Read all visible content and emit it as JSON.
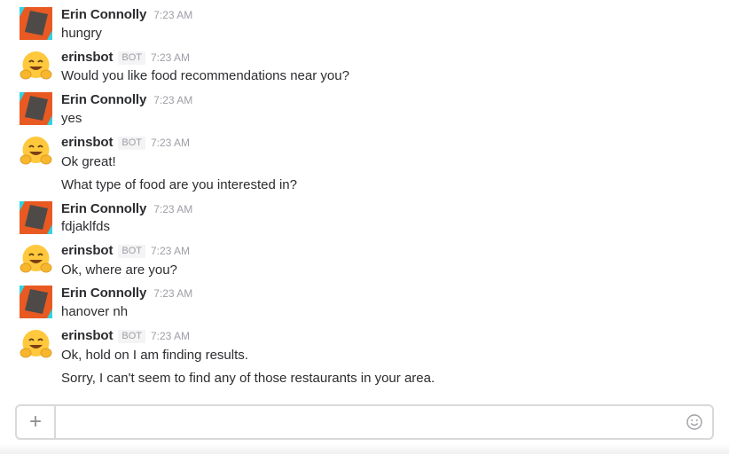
{
  "messages": [
    {
      "sender": "Erin Connolly",
      "is_bot": false,
      "time": "7:23 AM",
      "lines": [
        "hungry"
      ]
    },
    {
      "sender": "erinsbot",
      "is_bot": true,
      "badge": "BOT",
      "time": "7:23 AM",
      "lines": [
        "Would you like food recommendations near you?"
      ]
    },
    {
      "sender": "Erin Connolly",
      "is_bot": false,
      "time": "7:23 AM",
      "lines": [
        "yes"
      ]
    },
    {
      "sender": "erinsbot",
      "is_bot": true,
      "badge": "BOT",
      "time": "7:23 AM",
      "lines": [
        "Ok great!",
        "What type of food are you interested in?"
      ]
    },
    {
      "sender": "Erin Connolly",
      "is_bot": false,
      "time": "7:23 AM",
      "lines": [
        "fdjaklfds"
      ]
    },
    {
      "sender": "erinsbot",
      "is_bot": true,
      "badge": "BOT",
      "time": "7:23 AM",
      "lines": [
        "Ok, where are you?"
      ]
    },
    {
      "sender": "Erin Connolly",
      "is_bot": false,
      "time": "7:23 AM",
      "lines": [
        "hanover nh"
      ]
    },
    {
      "sender": "erinsbot",
      "is_bot": true,
      "badge": "BOT",
      "time": "7:23 AM",
      "lines": [
        "Ok, hold on I am finding results.",
        "Sorry, I can't seem to find any of those restaurants in your area."
      ]
    }
  ],
  "composer": {
    "plus_label": "+",
    "input_value": "",
    "input_placeholder": "",
    "emoji_icon": "smiley-face-icon",
    "plus_icon": "plus-icon"
  },
  "icons": {
    "user_avatar": "erin-connolly-avatar",
    "bot_avatar": "hugging-face-emoji-avatar"
  },
  "colors": {
    "avatar_cyan": "#2fd3e3",
    "avatar_orange": "#e85a22",
    "avatar_dark": "#4e4a47",
    "bot_yellow": "#ffc83d",
    "text": "#2c2d30",
    "muted": "#9e9ea6"
  }
}
